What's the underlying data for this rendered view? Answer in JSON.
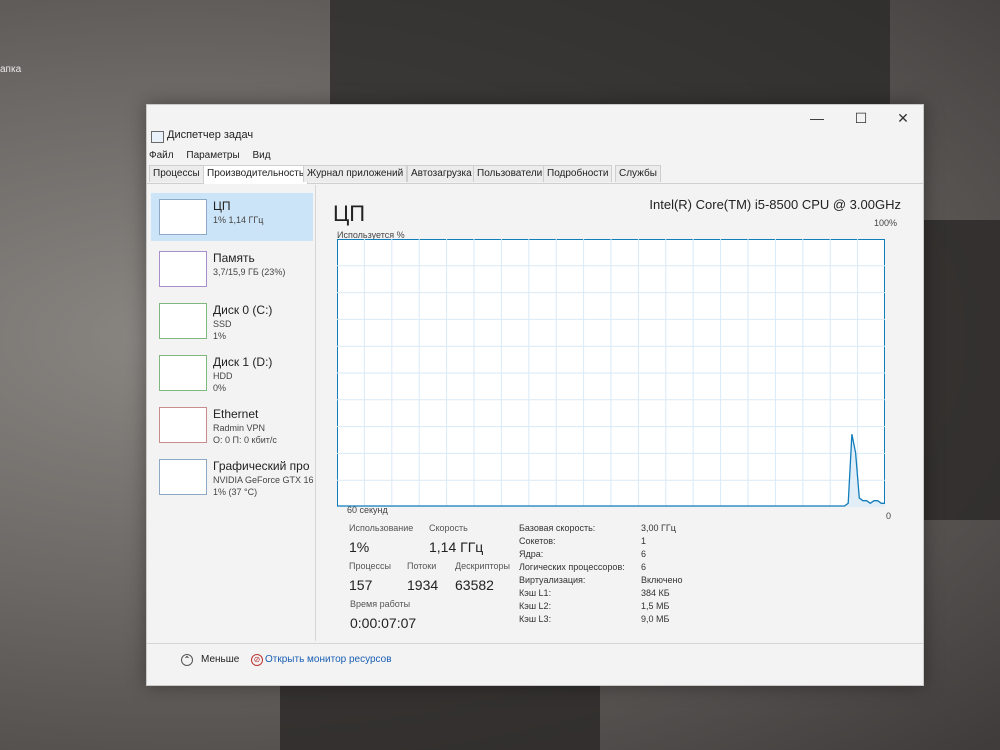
{
  "desktop": {
    "label": "апка"
  },
  "window": {
    "title": "Диспетчер задач",
    "controls": {
      "minimize": "—",
      "maximize": "☐",
      "close": "✕"
    }
  },
  "menu": [
    "Файл",
    "Параметры",
    "Вид"
  ],
  "tabs": [
    "Процессы",
    "Производительность",
    "Журнал приложений",
    "Автозагрузка",
    "Пользователи",
    "Подробности",
    "Службы"
  ],
  "resources": [
    {
      "name": "ЦП",
      "line1": "1% 1,14 ГГц",
      "line2": ""
    },
    {
      "name": "Память",
      "line1": "3,7/15,9 ГБ (23%)",
      "line2": ""
    },
    {
      "name": "Диск 0 (C:)",
      "line1": "SSD",
      "line2": "1%"
    },
    {
      "name": "Диск 1 (D:)",
      "line1": "HDD",
      "line2": "0%"
    },
    {
      "name": "Ethernet",
      "line1": "Radmin VPN",
      "line2": "О: 0 П: 0 кбит/с"
    },
    {
      "name": "Графический про",
      "line1": "NVIDIA GeForce GTX 16",
      "line2": "1% (37 °C)"
    }
  ],
  "main": {
    "title": "ЦП",
    "cpu_model": "Intel(R) Core(TM) i5-8500 CPU @ 3.00GHz",
    "graph_label": "Используется %",
    "graph_max": "100%",
    "graph_time": "60 секунд",
    "graph_min": "0"
  },
  "usage_history": [
    0,
    0,
    0,
    0,
    0,
    0,
    0,
    0,
    0,
    0,
    0,
    0,
    0,
    0,
    0,
    0,
    0,
    0,
    0,
    0,
    0,
    0,
    0,
    0,
    0,
    0,
    0,
    0,
    0,
    0,
    0,
    0,
    0,
    0,
    0,
    0,
    0,
    0,
    0,
    0,
    0,
    0,
    0,
    0,
    0,
    0,
    0,
    0,
    0,
    0,
    0,
    0,
    0,
    0,
    0,
    0,
    0,
    0,
    0,
    0,
    0,
    0,
    0,
    0,
    0,
    0,
    0,
    0,
    0,
    0,
    0,
    0,
    0,
    0,
    0,
    0,
    0,
    0,
    0,
    0,
    0,
    0,
    0,
    0,
    0,
    0,
    0,
    0,
    0,
    0,
    0,
    0,
    0,
    0,
    0,
    0,
    0,
    0,
    0,
    0,
    0,
    0,
    0,
    0,
    0,
    0,
    0,
    0,
    0,
    0,
    0,
    0,
    0,
    0,
    0,
    0,
    0,
    0,
    0,
    0,
    0,
    0,
    0,
    0,
    0,
    0,
    0,
    0,
    0,
    0,
    0,
    0,
    0,
    0,
    0,
    0,
    0,
    0,
    0,
    1,
    27,
    20,
    3,
    2,
    2,
    1,
    2,
    2,
    1,
    1
  ],
  "stats": {
    "usage_label": "Использование",
    "usage_value": "1%",
    "speed_label": "Скорость",
    "speed_value": "1,14 ГГц",
    "processes_label": "Процессы",
    "processes_value": "157",
    "threads_label": "Потоки",
    "threads_value": "1934",
    "handles_label": "Дескрипторы",
    "handles_value": "63582",
    "uptime_label": "Время работы",
    "uptime_value": "0:00:07:07"
  },
  "info": [
    {
      "k": "Базовая скорость:",
      "v": "3,00 ГГц"
    },
    {
      "k": "Сокетов:",
      "v": "1"
    },
    {
      "k": "Ядра:",
      "v": "6"
    },
    {
      "k": "Логических процессоров:",
      "v": "6"
    },
    {
      "k": "Виртуализация:",
      "v": "Включено"
    },
    {
      "k": "Кэш L1:",
      "v": "384 КБ"
    },
    {
      "k": "Кэш L2:",
      "v": "1,5 МБ"
    },
    {
      "k": "Кэш L3:",
      "v": "9,0 МБ"
    }
  ],
  "footer": {
    "less": "Меньше",
    "monitor": "Открыть монитор ресурсов"
  },
  "colors": {
    "accent": "#1a5fb4",
    "selected": "#cce4f7",
    "graph_line": "#117dbb",
    "graph_fill": "#e1eef8"
  }
}
